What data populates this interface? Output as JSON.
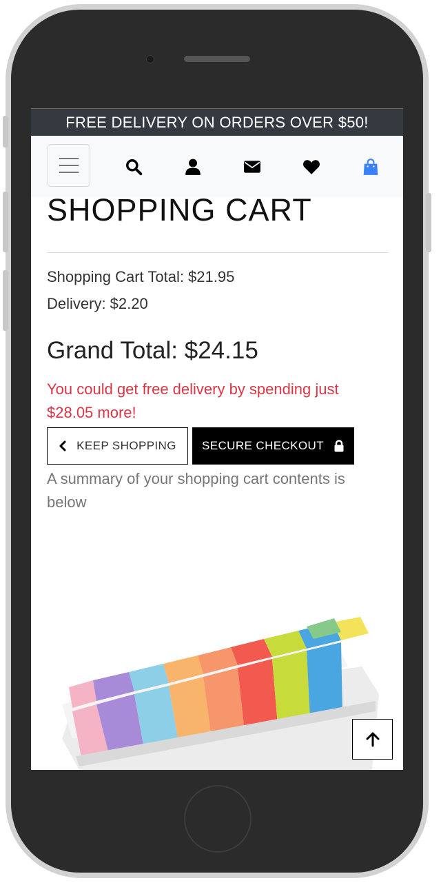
{
  "banner": {
    "text": "FREE DELIVERY ON ORDERS OVER $50!"
  },
  "navbar": {
    "icons": [
      "menu-icon",
      "search-icon",
      "user-icon",
      "envelope-icon",
      "heart-icon",
      "shopping-bag-icon"
    ],
    "bag_color": "#3b82f6"
  },
  "cart": {
    "title": "SHOPPING CART",
    "subtotal": "Shopping Cart Total: $21.95",
    "delivery": "Delivery: $2.20",
    "grand_total": "Grand Total: $24.15",
    "free_delivery_msg": "You could get free delivery by spending just $28.05 more!",
    "keep_shopping_label": "KEEP SHOPPING",
    "checkout_label": "SECURE CHECKOUT",
    "summary_text": "A summary of your shopping cart contents is below"
  },
  "product": {
    "image_name": "washi-tape-box-image"
  },
  "colors": {
    "banner_bg": "#343a40",
    "alert": "#dc3545",
    "navbar_bg": "#f8f9fa"
  }
}
